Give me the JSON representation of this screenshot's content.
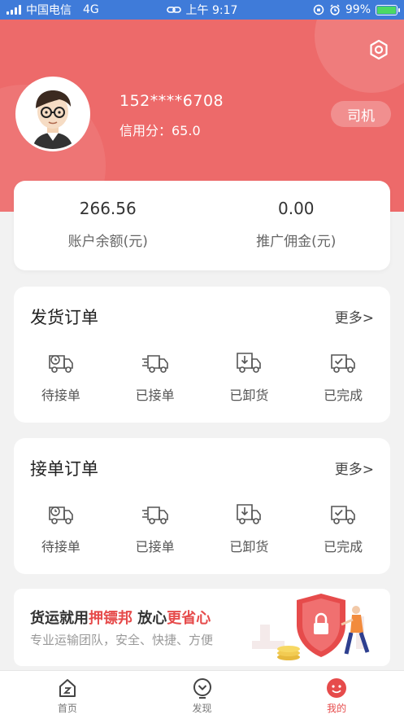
{
  "status_bar": {
    "carrier": "中国电信",
    "network": "4G",
    "time": "上午 9:17",
    "battery": "99%",
    "battery_level": 0.99
  },
  "profile": {
    "phone": "152****6708",
    "credit": "信用分：65.0",
    "role": "司机"
  },
  "balance": {
    "account_value": "266.56",
    "account_label": "账户余额(元)",
    "commission_value": "0.00",
    "commission_label": "推广佣金(元)"
  },
  "shipping_orders": {
    "title": "发货订单",
    "more": "更多>",
    "items": [
      {
        "label": "待接单",
        "icon": "truck-clock-icon"
      },
      {
        "label": "已接单",
        "icon": "truck-fast-icon"
      },
      {
        "label": "已卸货",
        "icon": "truck-unload-icon"
      },
      {
        "label": "已完成",
        "icon": "truck-check-icon"
      }
    ]
  },
  "accepted_orders": {
    "title": "接单订单",
    "more": "更多>",
    "items": [
      {
        "label": "待接单",
        "icon": "truck-clock-icon"
      },
      {
        "label": "已接单",
        "icon": "truck-fast-icon"
      },
      {
        "label": "已卸货",
        "icon": "truck-unload-icon"
      },
      {
        "label": "已完成",
        "icon": "truck-check-icon"
      }
    ]
  },
  "banner": {
    "part1": "货运就用",
    "brand": "押镖邦",
    "part2": " 放心",
    "highlight": "更省心",
    "subtitle": "专业运输团队，安全、快捷、方便"
  },
  "tabbar": {
    "items": [
      {
        "label": "首页",
        "icon": "home-icon"
      },
      {
        "label": "发现",
        "icon": "discover-icon"
      },
      {
        "label": "我的",
        "icon": "profile-icon"
      }
    ]
  },
  "colors": {
    "accent": "#ed6a6a",
    "active_tab": "#e64b4b",
    "status_bar": "#3f7bd9"
  }
}
